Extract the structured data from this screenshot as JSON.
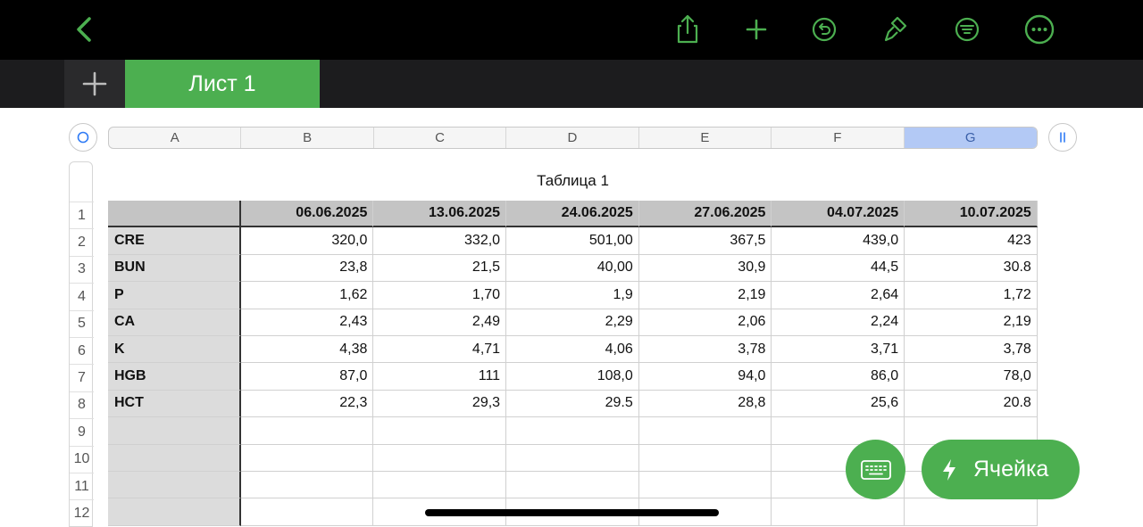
{
  "toolbar": {
    "icons": [
      "back-chevron-icon",
      "share-icon",
      "add-icon",
      "undo-icon",
      "format-brush-icon",
      "filter-icon",
      "more-icon"
    ],
    "accent_color": "#4caf50"
  },
  "tabs": {
    "active_label": "Лист 1"
  },
  "columns": [
    "A",
    "B",
    "C",
    "D",
    "E",
    "F",
    "G"
  ],
  "selected_column": "G",
  "row_numbers": [
    "1",
    "2",
    "3",
    "4",
    "5",
    "6",
    "7",
    "8",
    "9",
    "10",
    "11",
    "12"
  ],
  "table": {
    "title": "Таблица 1",
    "header": [
      "",
      "06.06.2025",
      "13.06.2025",
      "24.06.2025",
      "27.06.2025",
      "04.07.2025",
      "10.07.2025"
    ],
    "rows": [
      [
        "CRE",
        "320,0",
        "332,0",
        "501,00",
        "367,5",
        "439,0",
        "423"
      ],
      [
        "BUN",
        "23,8",
        "21,5",
        "40,00",
        "30,9",
        "44,5",
        "30.8"
      ],
      [
        "P",
        "1,62",
        "1,70",
        "1,9",
        "2,19",
        "2,64",
        "1,72"
      ],
      [
        "CA",
        "2,43",
        "2,49",
        "2,29",
        "2,06",
        "2,24",
        "2,19"
      ],
      [
        "K",
        "4,38",
        "4,71",
        "4,06",
        "3,78",
        "3,71",
        "3,78"
      ],
      [
        "HGB",
        "87,0",
        "111",
        "108,0",
        "94,0",
        "86,0",
        "78,0"
      ],
      [
        "HCT",
        "22,3",
        "29,3",
        "29.5",
        "28,8",
        "25,6",
        "20.8"
      ],
      [
        "",
        "",
        "",
        "",
        "",
        "",
        ""
      ],
      [
        "",
        "",
        "",
        "",
        "",
        "",
        ""
      ],
      [
        "",
        "",
        "",
        "",
        "",
        "",
        ""
      ],
      [
        "",
        "",
        "",
        "",
        "",
        "",
        ""
      ]
    ]
  },
  "fab": {
    "cell_label": "Ячейка"
  }
}
